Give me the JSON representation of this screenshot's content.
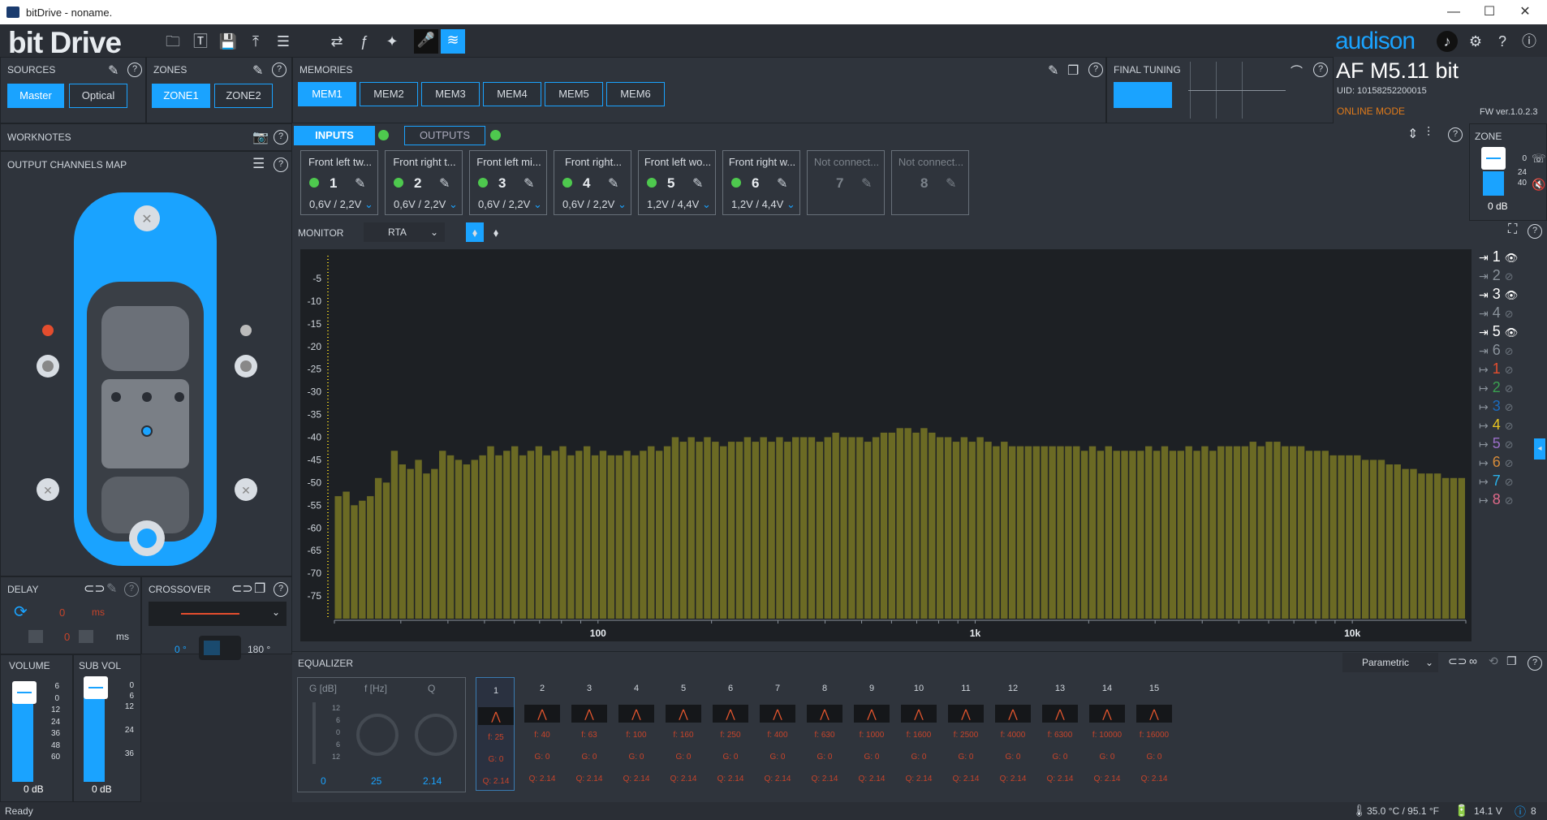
{
  "window": {
    "title": "bitDrive - noname.",
    "minimize": "—",
    "maximize": "☐",
    "close": "✕"
  },
  "logo": "bit Drive",
  "brand": "audison",
  "sources": {
    "title": "SOURCES",
    "items": [
      {
        "label": "Master",
        "active": true
      },
      {
        "label": "Optical",
        "active": false
      }
    ]
  },
  "zones": {
    "title": "ZONES",
    "items": [
      {
        "label": "ZONE1",
        "active": true
      },
      {
        "label": "ZONE2",
        "active": false
      }
    ]
  },
  "memories": {
    "title": "MEMORIES",
    "items": [
      {
        "label": "MEM1",
        "active": true
      },
      {
        "label": "MEM2"
      },
      {
        "label": "MEM3"
      },
      {
        "label": "MEM4"
      },
      {
        "label": "MEM5"
      },
      {
        "label": "MEM6"
      }
    ]
  },
  "final_tuning": {
    "title": "FINAL TUNING"
  },
  "device": {
    "name": "AF M5.11 bit",
    "uid": "UID: 10158252200015",
    "mode": "ONLINE MODE",
    "fw": "FW ver.1.0.2.3"
  },
  "worknotes": {
    "title": "WORKNOTES"
  },
  "output_map": {
    "title": "OUTPUT CHANNELS MAP"
  },
  "io_tabs": {
    "inputs": "INPUTS",
    "outputs": "OUTPUTS"
  },
  "channels": [
    {
      "label": "Front left tw...",
      "num": "1",
      "volt": "0,6V / 2,2V",
      "connected": true
    },
    {
      "label": "Front right t...",
      "num": "2",
      "volt": "0,6V / 2,2V",
      "connected": true
    },
    {
      "label": "Front left mi...",
      "num": "3",
      "volt": "0,6V / 2,2V",
      "connected": true
    },
    {
      "label": "Front right...",
      "num": "4",
      "volt": "0,6V / 2,2V",
      "connected": true
    },
    {
      "label": "Front left wo...",
      "num": "5",
      "volt": "1,2V / 4,4V",
      "connected": true
    },
    {
      "label": "Front right w...",
      "num": "6",
      "volt": "1,2V / 4,4V",
      "connected": true
    },
    {
      "label": "Not connect...",
      "num": "7",
      "volt": "",
      "connected": false
    },
    {
      "label": "Not connect...",
      "num": "8",
      "volt": "",
      "connected": false
    }
  ],
  "zone_panel": {
    "title": "ZONE",
    "ticks": [
      "0",
      "24",
      "40"
    ],
    "value": "0 dB"
  },
  "monitor": {
    "title": "MONITOR",
    "mode": "RTA"
  },
  "chart_data": {
    "type": "bar",
    "title": "",
    "xlabel": "",
    "ylabel": "",
    "x_ticks": [
      "100",
      "1k",
      "10k"
    ],
    "y_ticks": [
      "-5",
      "-10",
      "-15",
      "-20",
      "-25",
      "-30",
      "-35",
      "-40",
      "-45",
      "-50",
      "-55",
      "-60",
      "-65",
      "-70",
      "-75"
    ],
    "ylim": [
      -80,
      0
    ],
    "values": [
      -53,
      -52,
      -55,
      -54,
      -53,
      -49,
      -50,
      -43,
      -46,
      -47,
      -45,
      -48,
      -47,
      -43,
      -44,
      -45,
      -46,
      -45,
      -44,
      -42,
      -44,
      -43,
      -42,
      -44,
      -43,
      -42,
      -44,
      -43,
      -42,
      -44,
      -43,
      -42,
      -44,
      -43,
      -44,
      -44,
      -43,
      -44,
      -43,
      -42,
      -43,
      -42,
      -40,
      -41,
      -40,
      -41,
      -40,
      -41,
      -42,
      -41,
      -41,
      -40,
      -41,
      -40,
      -41,
      -40,
      -41,
      -40,
      -40,
      -40,
      -41,
      -40,
      -39,
      -40,
      -40,
      -40,
      -41,
      -40,
      -39,
      -39,
      -38,
      -38,
      -39,
      -38,
      -39,
      -40,
      -40,
      -41,
      -40,
      -41,
      -40,
      -41,
      -42,
      -41,
      -42,
      -42,
      -42,
      -42,
      -42,
      -42,
      -42,
      -42,
      -42,
      -43,
      -42,
      -43,
      -42,
      -43,
      -43,
      -43,
      -43,
      -42,
      -43,
      -42,
      -43,
      -43,
      -42,
      -43,
      -42,
      -43,
      -42,
      -42,
      -42,
      -42,
      -41,
      -42,
      -41,
      -41,
      -42,
      -42,
      -42,
      -43,
      -43,
      -43,
      -44,
      -44,
      -44,
      -44,
      -45,
      -45,
      -45,
      -46,
      -46,
      -47,
      -47,
      -48,
      -48,
      -48,
      -49,
      -49,
      -49
    ],
    "color": "#6b6a24"
  },
  "chan_list": [
    {
      "num": "1",
      "type": "in",
      "visible": true
    },
    {
      "num": "2",
      "type": "in",
      "visible": false
    },
    {
      "num": "3",
      "type": "in",
      "visible": true
    },
    {
      "num": "4",
      "type": "in",
      "visible": false
    },
    {
      "num": "5",
      "type": "in",
      "visible": true
    },
    {
      "num": "6",
      "type": "in",
      "visible": false
    },
    {
      "num": "1",
      "type": "out",
      "color": "#e44d2e"
    },
    {
      "num": "2",
      "type": "out",
      "color": "#3aa050"
    },
    {
      "num": "3",
      "type": "out",
      "color": "#1a6bbf"
    },
    {
      "num": "4",
      "type": "out",
      "color": "#e8c420"
    },
    {
      "num": "5",
      "type": "out",
      "color": "#9a6ec8"
    },
    {
      "num": "6",
      "type": "out",
      "color": "#d48a3a"
    },
    {
      "num": "7",
      "type": "out",
      "color": "#2ab0e8"
    },
    {
      "num": "8",
      "type": "out",
      "color": "#e06a8a"
    }
  ],
  "delay": {
    "title": "DELAY",
    "value_ms": "0",
    "unit": "ms",
    "value2": "0",
    "unit2": "ms"
  },
  "crossover": {
    "title": "CROSSOVER",
    "phase0": "0 °",
    "phase180": "180 °"
  },
  "volume": {
    "title": "VOLUME",
    "ticks": [
      "6",
      "0",
      "12",
      "24",
      "36",
      "48",
      "60"
    ],
    "value": "0 dB"
  },
  "sub_vol": {
    "title": "SUB VOL",
    "ticks": [
      "0",
      "6",
      "12",
      "24",
      "36"
    ],
    "value": "0 dB"
  },
  "equalizer": {
    "title": "EQUALIZER",
    "mode": "Parametric",
    "knob_labels": {
      "g": "G [dB]",
      "f": "f [Hz]",
      "q": "Q"
    },
    "g_ticks": [
      "12",
      "6",
      "0",
      "6",
      "12"
    ],
    "knob_values": {
      "g": "0",
      "f": "25",
      "q": "2.14"
    },
    "bands": [
      {
        "n": "1",
        "f": "f: 25",
        "g": "G: 0",
        "q": "Q: 2.14"
      },
      {
        "n": "2",
        "f": "f: 40",
        "g": "G: 0",
        "q": "Q: 2.14"
      },
      {
        "n": "3",
        "f": "f: 63",
        "g": "G: 0",
        "q": "Q: 2.14"
      },
      {
        "n": "4",
        "f": "f: 100",
        "g": "G: 0",
        "q": "Q: 2.14"
      },
      {
        "n": "5",
        "f": "f: 160",
        "g": "G: 0",
        "q": "Q: 2.14"
      },
      {
        "n": "6",
        "f": "f: 250",
        "g": "G: 0",
        "q": "Q: 2.14"
      },
      {
        "n": "7",
        "f": "f: 400",
        "g": "G: 0",
        "q": "Q: 2.14"
      },
      {
        "n": "8",
        "f": "f: 630",
        "g": "G: 0",
        "q": "Q: 2.14"
      },
      {
        "n": "9",
        "f": "f: 1000",
        "g": "G: 0",
        "q": "Q: 2.14"
      },
      {
        "n": "10",
        "f": "f: 1600",
        "g": "G: 0",
        "q": "Q: 2.14"
      },
      {
        "n": "11",
        "f": "f: 2500",
        "g": "G: 0",
        "q": "Q: 2.14"
      },
      {
        "n": "12",
        "f": "f: 4000",
        "g": "G: 0",
        "q": "Q: 2.14"
      },
      {
        "n": "13",
        "f": "f: 6300",
        "g": "G: 0",
        "q": "Q: 2.14"
      },
      {
        "n": "14",
        "f": "f: 10000",
        "g": "G: 0",
        "q": "Q: 2.14"
      },
      {
        "n": "15",
        "f": "f: 16000",
        "g": "G: 0",
        "q": "Q: 2.14"
      }
    ]
  },
  "status": {
    "ready": "Ready",
    "temp": "35.0 °C / 95.1 °F",
    "voltage": "14.1 V",
    "info_count": "8"
  }
}
